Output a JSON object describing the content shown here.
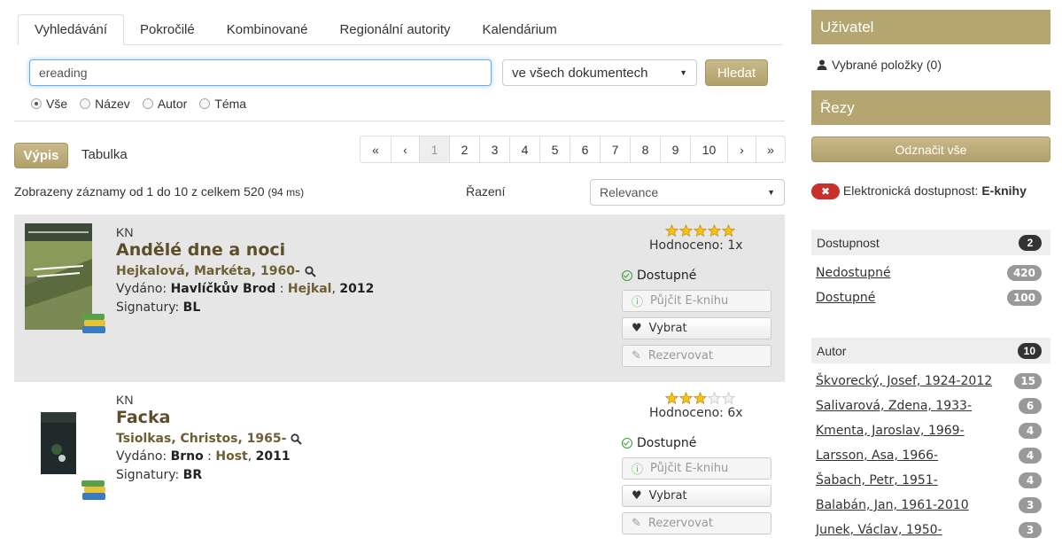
{
  "tabs": [
    "Vyhledávání",
    "Pokročilé",
    "Kombinované",
    "Regionální autority",
    "Kalendárium"
  ],
  "search": {
    "value": "ereading",
    "scope": "ve všech dokumentech",
    "button": "Hledat",
    "radios": [
      {
        "label": "Vše",
        "checked": true
      },
      {
        "label": "Název",
        "checked": false
      },
      {
        "label": "Autor",
        "checked": false
      },
      {
        "label": "Téma",
        "checked": false
      }
    ]
  },
  "view": {
    "list": "Výpis",
    "table": "Tabulka"
  },
  "pager": [
    "«",
    "‹",
    "1",
    "2",
    "3",
    "4",
    "5",
    "6",
    "7",
    "8",
    "9",
    "10",
    "›",
    "»"
  ],
  "pager_active": "1",
  "summary": {
    "text": "Zobrazeny záznamy od 1 do 10 z celkem 520",
    "time": "(94 ms)"
  },
  "sort": {
    "label": "Řazení",
    "value": "Relevance"
  },
  "results": [
    {
      "type": "KN",
      "title": "Andělé dne a noci",
      "author": "Hejkalová, Markéta, 1960-",
      "issued_label": "Vydáno:",
      "place": "Havlíčkův Brod",
      "publisher": "Hejkal",
      "year": "2012",
      "sig_label": "Signatury:",
      "signature": "BL",
      "rating_stars": 5,
      "rated": "Hodnoceno: 1x",
      "availability": "Dostupné",
      "actions": [
        "Půjčit E-knihu",
        "Vybrat",
        "Rezervovat"
      ]
    },
    {
      "type": "KN",
      "title": "Facka",
      "author": "Tsiolkas, Christos, 1965-",
      "issued_label": "Vydáno:",
      "place": "Brno",
      "publisher": "Host",
      "year": "2011",
      "sig_label": "Signatury:",
      "signature": "BR",
      "rating_stars": 3,
      "rated": "Hodnoceno: 6x",
      "availability": "Dostupné",
      "actions": [
        "Půjčit E-knihu",
        "Vybrat",
        "Rezervovat"
      ]
    }
  ],
  "sidebar": {
    "user_head": "Uživatel",
    "selected": "Vybrané položky (0)",
    "cuts_head": "Řezy",
    "unmark": "Odznačit vše",
    "active_filter_label": "Elektronická dostupnost:",
    "active_filter_value": "E-knihy",
    "availability": {
      "title": "Dostupnost",
      "count": "2",
      "items": [
        {
          "label": "Nedostupné",
          "count": "420"
        },
        {
          "label": "Dostupné",
          "count": "100"
        }
      ]
    },
    "author": {
      "title": "Autor",
      "count": "10",
      "items": [
        {
          "label": "Škvorecký, Josef, 1924-2012",
          "count": "15"
        },
        {
          "label": "Salivarová, Zdena, 1933-",
          "count": "6"
        },
        {
          "label": "Kmenta, Jaroslav, 1969-",
          "count": "4"
        },
        {
          "label": "Larsson, Asa, 1966-",
          "count": "4"
        },
        {
          "label": "Šabach, Petr, 1951-",
          "count": "4"
        },
        {
          "label": "Balabán, Jan, 1961-2010",
          "count": "3"
        },
        {
          "label": "Junek, Václav, 1950-",
          "count": "3"
        }
      ]
    }
  },
  "colors": {
    "accent": "#b5a570",
    "link": "#6e5e33",
    "badge_dark": "#333333",
    "remove": "#c9302c"
  }
}
